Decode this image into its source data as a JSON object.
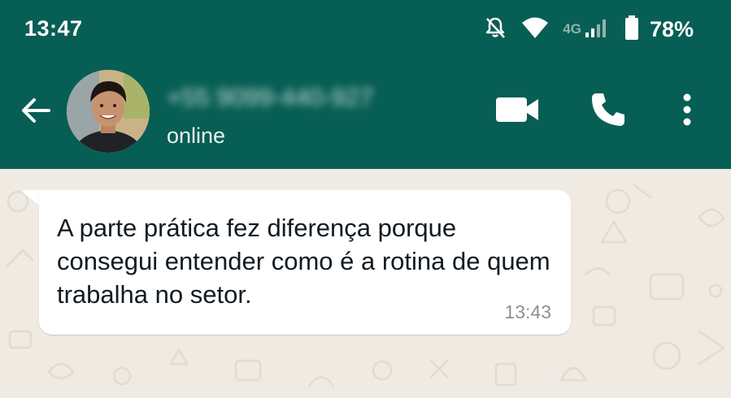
{
  "status_bar": {
    "time": "13:47",
    "network_label": "4G",
    "battery_percent": "78%",
    "icons": [
      "notifications-off-icon",
      "wifi-icon",
      "signal-icon",
      "battery-icon"
    ]
  },
  "header": {
    "contact_name": "+55 9099-440-927",
    "contact_status": "online",
    "icons": [
      "back-arrow-icon",
      "video-call-icon",
      "phone-icon",
      "more-vert-icon"
    ]
  },
  "messages": [
    {
      "text": "A parte prática fez diferença porque consegui entender como é a rotina de quem trabalha no setor.",
      "time": "13:43",
      "direction": "incoming"
    }
  ],
  "colors": {
    "header_bg": "#075e54",
    "chat_bg": "#efeae2",
    "bubble_bg": "#ffffff",
    "message_text": "#111b21",
    "timestamp": "#8a9296"
  }
}
